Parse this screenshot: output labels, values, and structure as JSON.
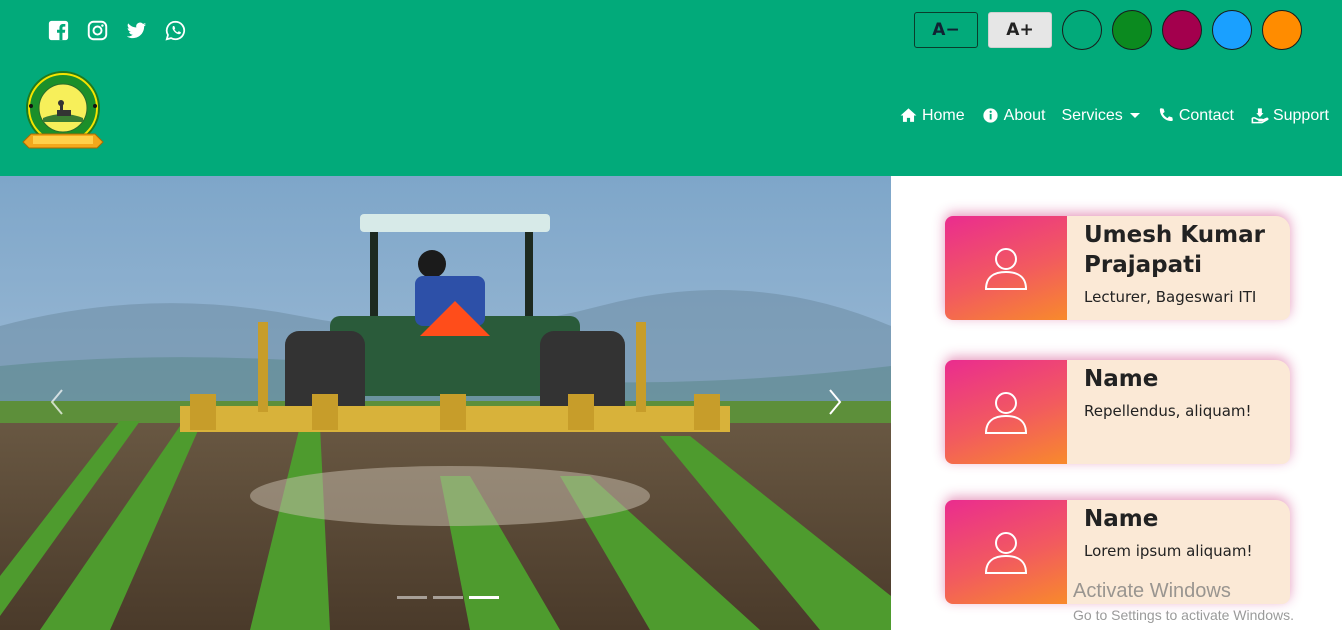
{
  "social": {
    "icons": [
      "facebook-icon",
      "instagram-icon",
      "twitter-icon",
      "whatsapp-icon"
    ]
  },
  "accessibility": {
    "decrease_label": "A−",
    "increase_label": "A+",
    "theme_colors": [
      "#02aa7a",
      "#0b8a1f",
      "#a3004d",
      "#1aa0ff",
      "#ff8c00"
    ]
  },
  "nav": {
    "home": "Home",
    "about": "About",
    "services": "Services",
    "contact": "Contact",
    "support": "Support"
  },
  "carousel": {
    "slide_count": 3,
    "active_slide": 3
  },
  "cards": [
    {
      "name": "Umesh Kumar Prajapati",
      "role": "Lecturer, Bageswari ITI"
    },
    {
      "name": "Name",
      "role": "Repellendus, aliquam!"
    },
    {
      "name": "Name",
      "role": "Lorem ipsum aliquam!"
    }
  ],
  "watermark": {
    "title": "Activate Windows",
    "subtitle": "Go to Settings to activate Windows."
  },
  "colors": {
    "header_bg": "#02aa7a",
    "card_bg": "#fbe9d6"
  }
}
